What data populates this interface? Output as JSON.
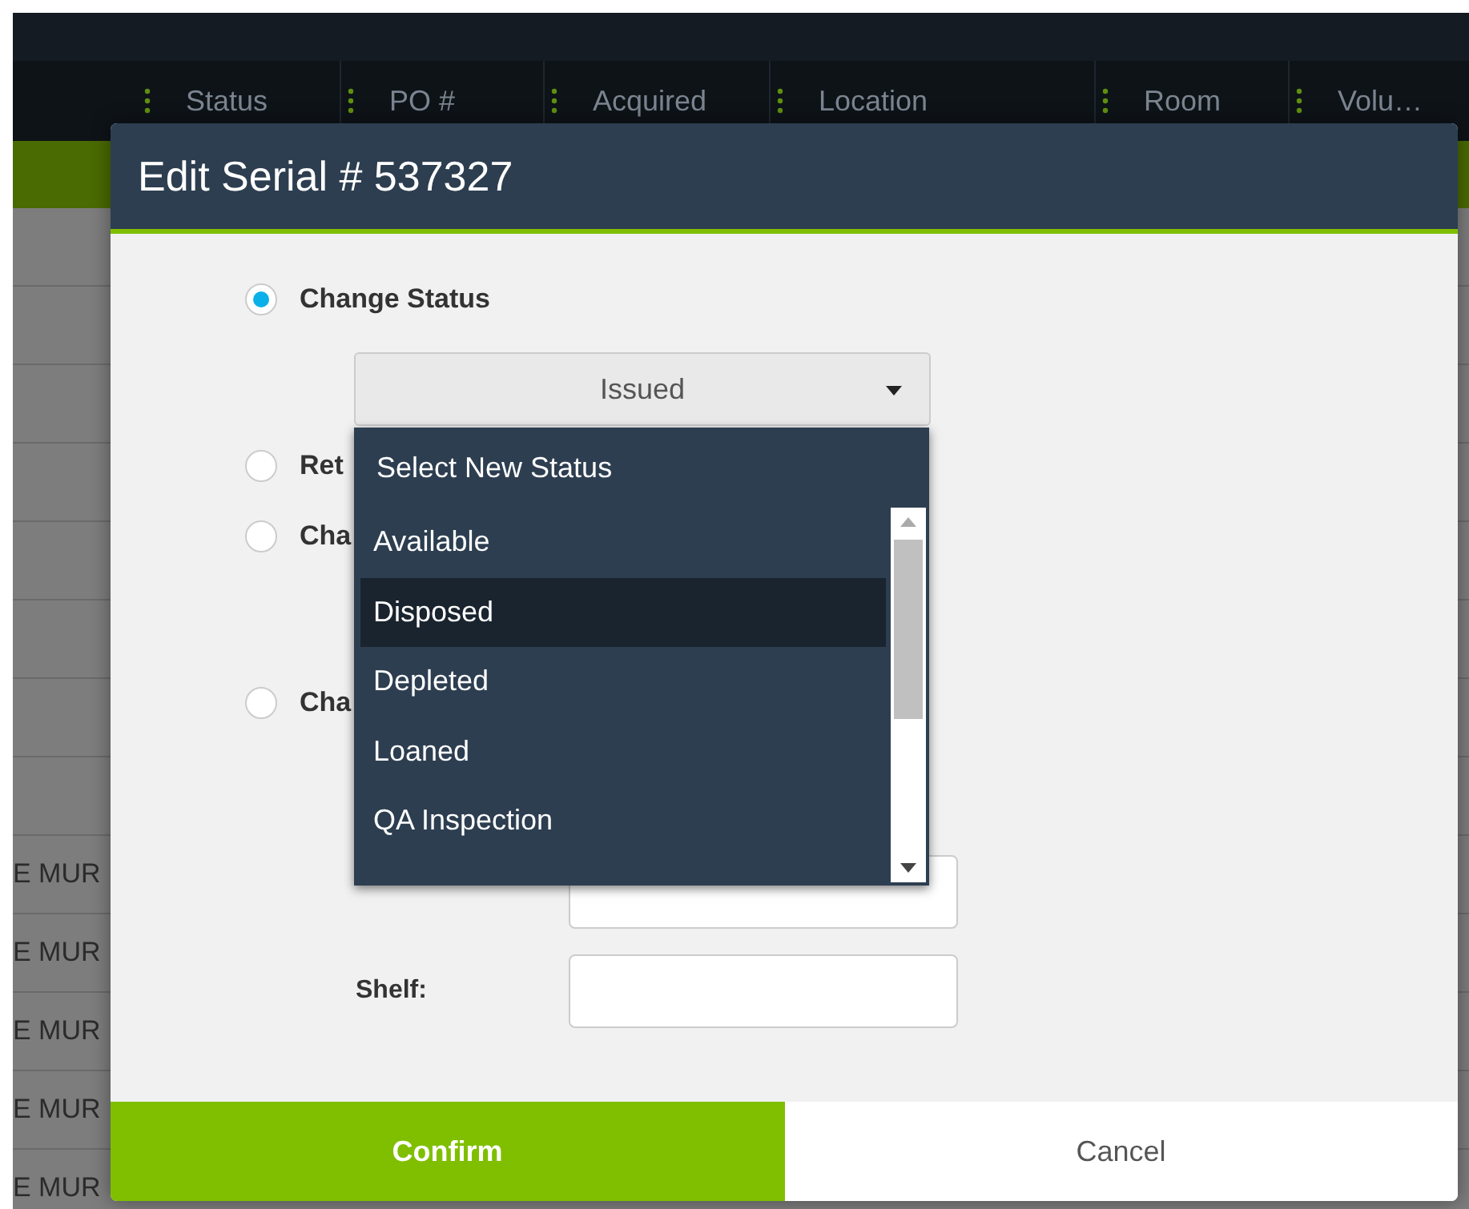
{
  "table": {
    "columns": [
      "Status",
      "PO #",
      "Acquired",
      "Location",
      "Room",
      "Volu…"
    ],
    "rows": [
      {
        "cell": ""
      },
      {
        "cell": ""
      },
      {
        "cell": ""
      },
      {
        "cell": ""
      },
      {
        "cell": ""
      },
      {
        "cell": ""
      },
      {
        "cell": ""
      },
      {
        "cell": ""
      },
      {
        "cell": "E MUR"
      },
      {
        "cell": "E MUR"
      },
      {
        "cell": "E MUR"
      },
      {
        "cell": "E MUR"
      },
      {
        "cell": "E MUR"
      }
    ]
  },
  "dialog": {
    "title": "Edit Serial # 537327",
    "options": [
      {
        "label": "Change Status",
        "selected": true
      },
      {
        "label": "Ret",
        "selected": false
      },
      {
        "label": "Cha",
        "selected": false
      },
      {
        "label": "Cha",
        "selected": false
      }
    ],
    "status_select": {
      "value": "Issued",
      "expanded": true,
      "items": [
        {
          "label": "Select New Status",
          "selected": false
        },
        {
          "label": "Available",
          "selected": false
        },
        {
          "label": "Disposed",
          "selected": true
        },
        {
          "label": "Depleted",
          "selected": false
        },
        {
          "label": "Loaned",
          "selected": false
        },
        {
          "label": "QA Inspection",
          "selected": false
        }
      ]
    },
    "shelf_label": "Shelf:",
    "buttons": [
      {
        "label": "Confirm",
        "kind": "primary"
      },
      {
        "label": "Cancel",
        "kind": "secondary"
      }
    ]
  }
}
